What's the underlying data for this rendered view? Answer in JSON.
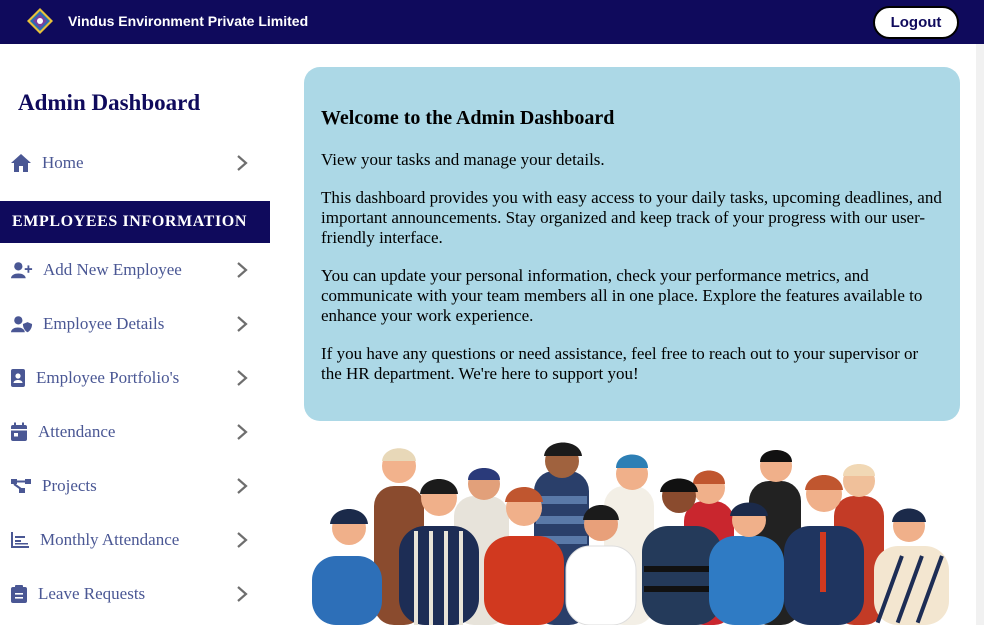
{
  "header": {
    "company_name": "Vindus Environment Private Limited",
    "logout_label": "Logout",
    "logo_icon": "diamond-logo-icon",
    "bg_color": "#0f0a5c"
  },
  "sidebar": {
    "title": "Admin Dashboard",
    "home": {
      "label": "Home",
      "icon": "home-icon"
    },
    "section_header": "EMPLOYEES INFORMATION",
    "items": [
      {
        "label": "Add New Employee",
        "icon": "user-plus-icon"
      },
      {
        "label": "Employee Details",
        "icon": "user-shield-icon"
      },
      {
        "label": "Employee Portfolio's",
        "icon": "id-badge-icon"
      },
      {
        "label": "Attendance",
        "icon": "calendar-icon"
      },
      {
        "label": "Projects",
        "icon": "project-diagram-icon"
      },
      {
        "label": "Monthly Attendance",
        "icon": "chart-bars-icon"
      },
      {
        "label": "Leave Requests",
        "icon": "clipboard-icon"
      }
    ]
  },
  "main": {
    "card_bg": "#acd8e6",
    "welcome_title": "Welcome to the Admin Dashboard",
    "paragraphs": [
      "View your tasks and manage your details.",
      "This dashboard provides you with easy access to your daily tasks, upcoming deadlines, and important announcements. Stay organized and keep track of your progress with our user-friendly interface.",
      "You can update your personal information, check your performance metrics, and communicate with your team members all in one place. Explore the features available to enhance your work experience.",
      "If you have any questions or need assistance, feel free to reach out to your supervisor or the HR department. We're here to support you!"
    ],
    "illustration": "team-people-illustration"
  }
}
